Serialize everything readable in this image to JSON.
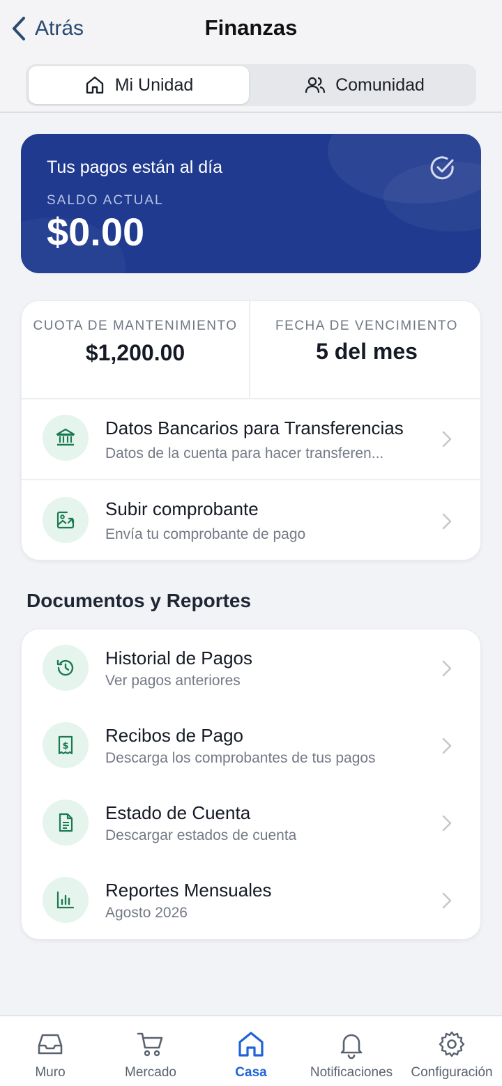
{
  "header": {
    "back_label": "Atrás",
    "title": "Finanzas"
  },
  "segments": {
    "active": "Mi Unidad",
    "inactive": "Comunidad"
  },
  "hero": {
    "status": "Tus pagos están al día",
    "balance_label": "SALDO ACTUAL",
    "balance": "$0.00",
    "color": "#1f3a8f"
  },
  "summary": {
    "fee_label": "CUOTA DE MANTENIMIENTO",
    "fee_value": "$1,200.00",
    "due_label": "FECHA DE VENCIMIENTO",
    "due_value": "5 del mes"
  },
  "actions": [
    {
      "title": "Datos Bancarios para Transferencias",
      "subtitle": "Datos de la cuenta para hacer transferen...",
      "icon": "bank-icon"
    },
    {
      "title": "Subir comprobante",
      "subtitle": "Envía tu comprobante de pago",
      "icon": "image-upload-icon"
    }
  ],
  "documents": {
    "section_title": "Documentos y Reportes",
    "items": [
      {
        "title": "Historial de Pagos",
        "subtitle": "Ver pagos anteriores",
        "icon": "history-icon"
      },
      {
        "title": "Recibos de Pago",
        "subtitle": "Descarga los comprobantes de tus pagos",
        "icon": "receipt-icon"
      },
      {
        "title": "Estado de Cuenta",
        "subtitle": "Descargar estados de cuenta",
        "icon": "document-icon"
      },
      {
        "title": "Reportes Mensuales",
        "subtitle": "Agosto 2026",
        "icon": "bar-chart-icon"
      }
    ]
  },
  "tabbar": {
    "items": [
      {
        "label": "Muro",
        "icon": "inbox-icon"
      },
      {
        "label": "Mercado",
        "icon": "cart-icon"
      },
      {
        "label": "Casa",
        "icon": "home-icon",
        "active": true
      },
      {
        "label": "Notificaciones",
        "icon": "bell-icon"
      },
      {
        "label": "Configuración",
        "icon": "gear-icon"
      }
    ]
  },
  "colors": {
    "accent": "#1f63d6",
    "icon_green": "#1a7a52",
    "icon_bg": "#e6f4ee"
  }
}
